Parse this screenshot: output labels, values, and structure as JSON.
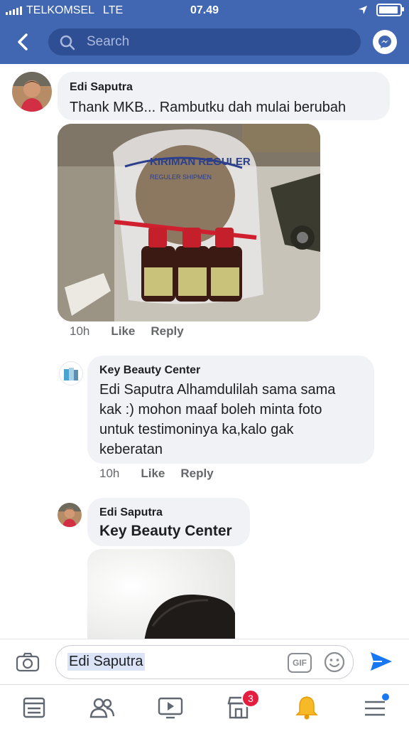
{
  "status": {
    "carrier": "TELKOMSEL",
    "network": "LTE",
    "time": "07.49"
  },
  "search": {
    "placeholder": "Search"
  },
  "comments": [
    {
      "author": "Edi Saputra",
      "text": "Thank MKB... Rambutku dah mulai berubah",
      "time": "10h",
      "like": "Like",
      "reply": "Reply"
    },
    {
      "author": "Key Beauty Center",
      "text_lines": [
        "Edi Saputra Alhamdulilah sama sama",
        "kak :) mohon maaf boleh minta foto",
        "untuk testimoninya ka,kalo gak",
        "keberatan"
      ],
      "time": "10h",
      "like": "Like",
      "reply": "Reply"
    },
    {
      "author": "Edi Saputra",
      "text": "Key Beauty Center"
    }
  ],
  "photo1_label": {
    "line1": "KIRIMAN REGULER",
    "line2": "REGULER SHIPMEN"
  },
  "composer": {
    "mention": "Edi Saputra",
    "gif_label": "GIF"
  },
  "tabs": {
    "notification_count": "3"
  },
  "colors": {
    "brand": "#4267b2",
    "search_bg": "#2f4f94",
    "badge": "#e41e3f",
    "accent": "#1877f2"
  }
}
